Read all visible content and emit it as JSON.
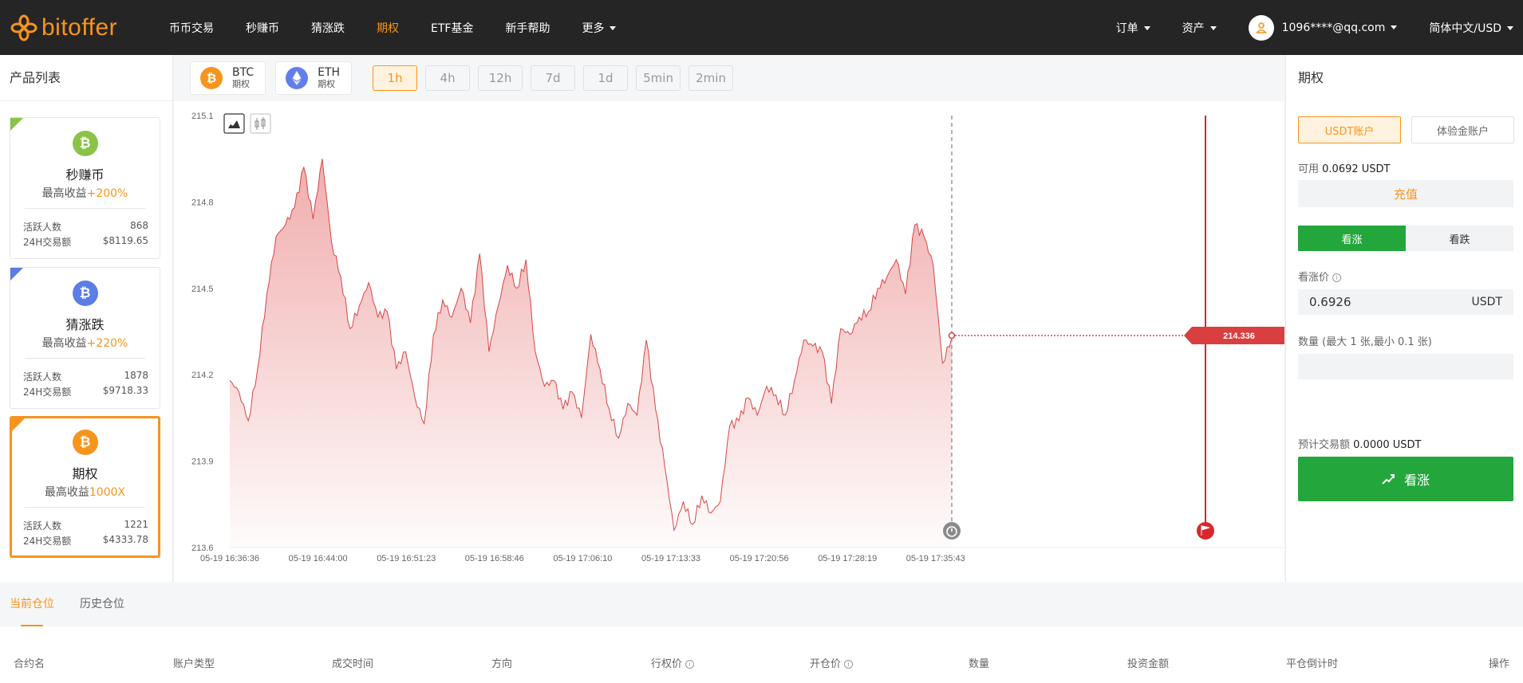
{
  "nav": {
    "logo_text": "bitoffer",
    "items": [
      {
        "label": "币币交易",
        "active": false
      },
      {
        "label": "秒赚币",
        "active": false
      },
      {
        "label": "猜涨跌",
        "active": false
      },
      {
        "label": "期权",
        "active": true
      },
      {
        "label": "ETF基金",
        "active": false
      },
      {
        "label": "新手帮助",
        "active": false
      },
      {
        "label": "更多",
        "active": false
      }
    ],
    "orders_label": "订单",
    "assets_label": "资产",
    "user_email": "1096****@qq.com",
    "language_label": "简体中文/USD"
  },
  "product_list": {
    "title": "产品列表",
    "cards": [
      {
        "name": "秒赚币",
        "yield_prefix": "最高收益",
        "yield_value": "+200%",
        "active_users_label": "活跃人数",
        "active_users": "868",
        "volume_label": "24H交易额",
        "volume": "$8119.65",
        "coin_color": "#8bc34a",
        "corner_color": "#8bc34a"
      },
      {
        "name": "猜涨跌",
        "yield_prefix": "最高收益",
        "yield_value": "+220%",
        "active_users_label": "活跃人数",
        "active_users": "1878",
        "volume_label": "24H交易额",
        "volume": "$9718.33",
        "coin_color": "#5b7ee5",
        "corner_color": "#5b7ee5"
      },
      {
        "name": "期权",
        "yield_prefix": "最高收益",
        "yield_value": "1000X",
        "active_users_label": "活跃人数",
        "active_users": "1221",
        "volume_label": "24H交易额",
        "volume": "$4333.78",
        "coin_color": "#f7941d",
        "corner_color": "#f7941d"
      }
    ]
  },
  "coins": [
    {
      "symbol": "BTC",
      "sub": "期权",
      "color": "#f7941d",
      "glyph": "₿",
      "active": false
    },
    {
      "symbol": "ETH",
      "sub": "期权",
      "color": "#627eea",
      "glyph": "◆",
      "active": true
    }
  ],
  "timeframes": [
    {
      "label": "1h",
      "active": true
    },
    {
      "label": "4h",
      "active": false
    },
    {
      "label": "12h",
      "active": false
    },
    {
      "label": "7d",
      "active": false
    },
    {
      "label": "1d",
      "active": false
    },
    {
      "label": "5min",
      "active": false
    },
    {
      "label": "2min",
      "active": false
    }
  ],
  "chart_data": {
    "type": "area",
    "ylim": [
      213.6,
      215.1
    ],
    "y_ticks": [
      215.1,
      214.8,
      214.5,
      214.2,
      213.9,
      213.6
    ],
    "x_ticks": [
      "05-19 16:36:36",
      "05-19 16:44:00",
      "05-19 16:51:23",
      "05-19 16:58:46",
      "05-19 17:06:10",
      "05-19 17:13:33",
      "05-19 17:20:56",
      "05-19 17:28:19",
      "05-19 17:35:43"
    ],
    "current_price_label": "214.336",
    "current_price": 214.336,
    "series": [
      {
        "values": [
          214.18,
          214.14,
          214.04,
          214.22,
          214.48,
          214.68,
          214.72,
          214.78,
          214.92,
          214.74,
          214.95,
          214.66,
          214.54,
          214.36,
          214.44,
          214.52,
          214.4,
          214.42,
          214.22,
          214.28,
          214.12,
          214.03,
          214.34,
          214.46,
          214.4,
          214.5,
          214.38,
          214.62,
          214.28,
          214.44,
          214.58,
          214.5,
          214.6,
          214.28,
          214.16,
          214.18,
          214.08,
          214.14,
          214.05,
          214.34,
          214.22,
          214.08,
          213.98,
          214.1,
          214.06,
          214.32,
          214.08,
          213.88,
          213.66,
          213.76,
          213.68,
          213.78,
          213.72,
          213.76,
          214.02,
          214.04,
          214.12,
          214.06,
          214.16,
          214.13,
          214.06,
          214.18,
          214.32,
          214.3,
          214.28,
          214.1,
          214.36,
          214.34,
          214.4,
          214.42,
          214.5,
          214.54,
          214.6,
          214.48,
          214.72,
          214.68,
          214.58,
          214.24,
          214.33
        ]
      }
    ],
    "legend": "none"
  },
  "order_panel": {
    "title": "期权",
    "account_tabs": [
      {
        "label": "USDT账户",
        "active": true
      },
      {
        "label": "体验金账户",
        "active": false
      }
    ],
    "available_label": "可用",
    "available_value": "0.0692 USDT",
    "deposit_label": "充值",
    "direction_up": "看涨",
    "direction_down": "看跌",
    "price_label": "看涨价",
    "price_value": "0.6926",
    "price_unit": "USDT",
    "qty_label": "数量 (最大 1 张,最小 0.1 张)",
    "qty_value": "",
    "est_label": "预计交易额",
    "est_value": "0.0000 USDT",
    "submit_label": "看涨"
  },
  "positions": {
    "tabs": [
      {
        "label": "当前仓位",
        "active": true
      },
      {
        "label": "历史仓位",
        "active": false
      }
    ],
    "columns": [
      "合约名",
      "账户类型",
      "成交时间",
      "方向",
      "行权价",
      "开仓价",
      "数量",
      "投资金额",
      "平仓倒计时",
      "操作"
    ]
  }
}
